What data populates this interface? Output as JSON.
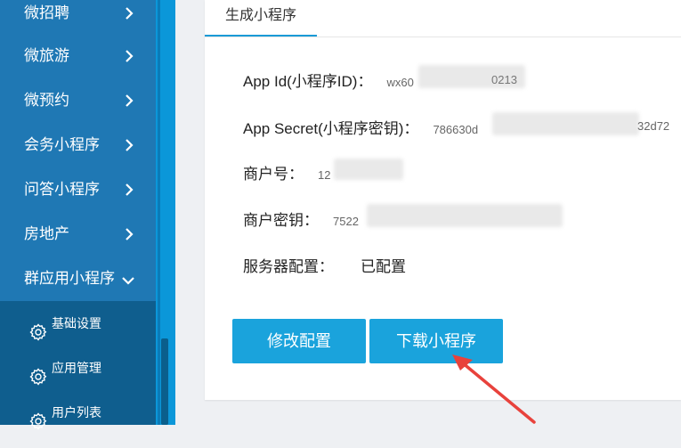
{
  "colors": {
    "sidebar": "#1f78b4",
    "subnav": "#0f5e8e",
    "rail": "#0b97d9",
    "accent": "#1aa3dc",
    "annotation_arrow": "#e8423c"
  },
  "sidebar": {
    "items": [
      {
        "label": "微招聘",
        "icon": "chevron-right-icon"
      },
      {
        "label": "微旅游",
        "icon": "chevron-right-icon"
      },
      {
        "label": "微预约",
        "icon": "chevron-right-icon"
      },
      {
        "label": "会务小程序",
        "icon": "chevron-right-icon"
      },
      {
        "label": "问答小程序",
        "icon": "chevron-right-icon"
      },
      {
        "label": "房地产",
        "icon": "chevron-right-icon"
      },
      {
        "label": "群应用小程序",
        "icon": "chevron-down-icon"
      }
    ],
    "subitems": [
      {
        "label": "基础设置",
        "icon": "gear-icon"
      },
      {
        "label": "应用管理",
        "icon": "gear-icon"
      },
      {
        "label": "用户列表",
        "icon": "gear-icon"
      }
    ]
  },
  "panel": {
    "tab": "生成小程序",
    "fields": {
      "app_id": {
        "label": "App Id(小程序ID)：",
        "value": "wx60",
        "value_tail": "0213"
      },
      "app_secret": {
        "label": "App Secret(小程序密钥)：",
        "value": "786630d",
        "value_tail": "32d72"
      },
      "merchant_no": {
        "label": "商户号：",
        "value": "12"
      },
      "merchant_key": {
        "label": "商户密钥：",
        "value": "7522"
      },
      "server_config": {
        "label": "服务器配置：",
        "value": "已配置"
      }
    },
    "buttons": {
      "modify": "修改配置",
      "download": "下载小程序"
    }
  }
}
